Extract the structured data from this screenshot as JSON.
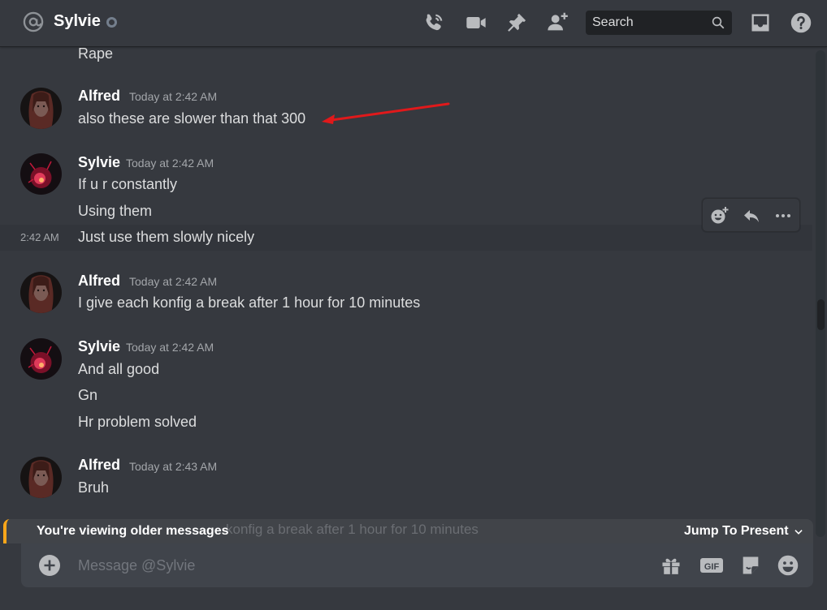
{
  "header": {
    "channel_name": "Sylvie",
    "search_placeholder": "Search"
  },
  "messages": {
    "partial_top": "Rape",
    "m1": {
      "author": "Alfred",
      "time": "Today at 2:42 AM",
      "lines": [
        "also these are slower than that 300"
      ]
    },
    "m2": {
      "author": "Sylvie",
      "time": "Today at 2:42 AM",
      "lines": [
        "If u r constantly",
        "Using them"
      ],
      "hover_time": "2:42 AM",
      "hover_line": "Just use them slowly nicely"
    },
    "m3": {
      "author": "Alfred",
      "time": "Today at 2:42 AM",
      "lines": [
        "I give each konfig a break after 1 hour for 10 minutes"
      ]
    },
    "m4": {
      "author": "Sylvie",
      "time": "Today at 2:42 AM",
      "lines": [
        "And all good",
        "Gn",
        "Hr problem solved"
      ]
    },
    "m5": {
      "author": "Alfred",
      "time": "Today at 2:43 AM",
      "lines": [
        "Bruh"
      ]
    }
  },
  "older_bar": {
    "label": "You're viewing older messages",
    "ghost_text": "konfig a break after 1 hour for 10 minutes",
    "jump_label": "Jump To Present"
  },
  "composer": {
    "placeholder": "Message @Sylvie"
  },
  "colors": {
    "annotation_arrow": "#e0191b",
    "older_accent": "#faa61a"
  }
}
